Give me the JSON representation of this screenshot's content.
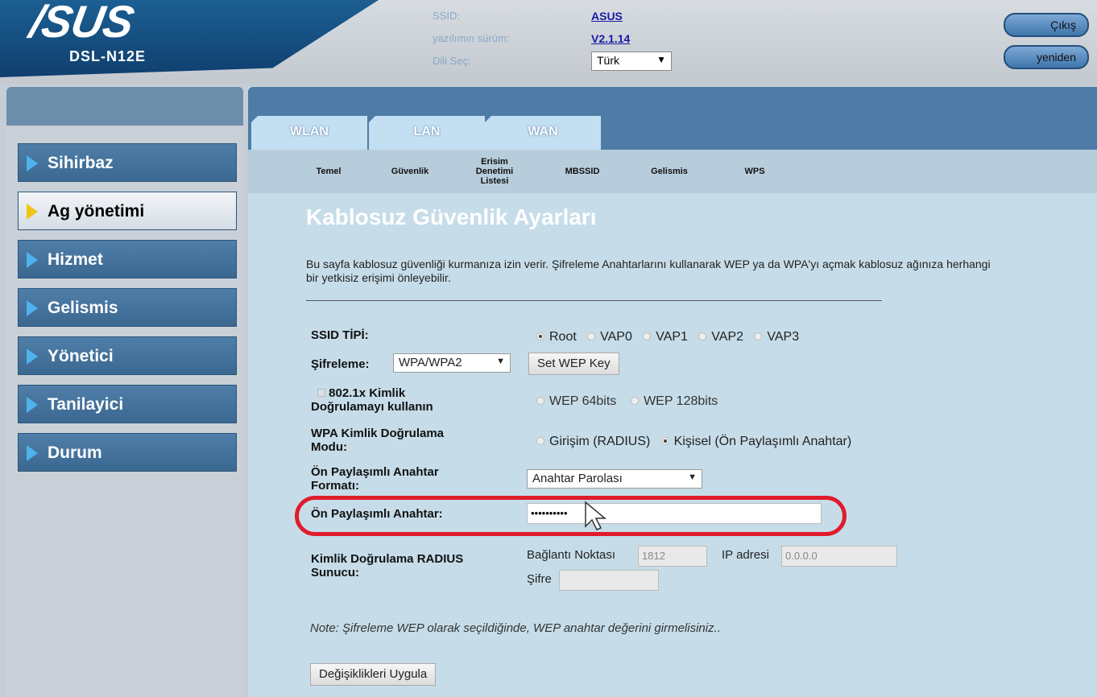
{
  "header": {
    "brand": "/SUS",
    "model": "DSL-N12E",
    "ssid_label": "SSID:",
    "ssid_value": "ASUS",
    "firmware_label": "yazılımın sürüm:",
    "firmware_value": "V2.1.14",
    "language_label": "Dili Seç:",
    "language_value": "Türk",
    "logout_label": "Çıkış",
    "reboot_label": "yeniden"
  },
  "sidebar": {
    "items": [
      {
        "label": "Sihirbaz"
      },
      {
        "label": "Ag yönetimi"
      },
      {
        "label": "Hizmet"
      },
      {
        "label": "Gelismis"
      },
      {
        "label": "Yönetici"
      },
      {
        "label": "Tanilayici"
      },
      {
        "label": "Durum"
      }
    ]
  },
  "tabs": [
    "WLAN",
    "LAN",
    "WAN"
  ],
  "subtabs": [
    "Temel",
    "Güvenlik",
    "Erisim Denetimi Listesi",
    "MBSSID",
    "Gelismis",
    "WPS"
  ],
  "page": {
    "title": "Kablosuz Güvenlik Ayarları",
    "description": "Bu sayfa kablosuz güvenliği kurmanıza izin verir. Şifreleme Anahtarlarını kullanarak WEP ya da WPA'yı açmak kablosuz ağınıza herhangi bir yetkisiz erişimi önleyebilir.",
    "ssid_type_label": "SSID TİPİ:",
    "ssid_types": [
      "Root",
      "VAP0",
      "VAP1",
      "VAP2",
      "VAP3"
    ],
    "encryption_label": "Şifreleme:",
    "encryption_value": "WPA/WPA2",
    "set_wep_key": "Set WEP Key",
    "dot1x_label_line1": "802.1x Kimlik",
    "dot1x_label_line2": "Doğrulamayı kullanın",
    "wep64": "WEP 64bits",
    "wep128": "WEP 128bits",
    "wpa_mode_label_line1": "WPA Kimlik Doğrulama",
    "wpa_mode_label_line2": "Modu:",
    "wpa_mode_enterprise": "Girişim (RADIUS)",
    "wpa_mode_personal": "Kişisel (Ön Paylaşımlı Anahtar)",
    "psk_format_label_line1": "Ön Paylaşımlı Anahtar",
    "psk_format_label_line2": "Formatı:",
    "psk_format_value": "Anahtar Parolası",
    "psk_label": "Ön Paylaşımlı Anahtar:",
    "psk_value": "••••••••••",
    "radius_label_line1": "Kimlik Doğrulama RADIUS",
    "radius_label_line2": "Sunucu:",
    "port_label": "Bağlantı Noktası",
    "port_value": "1812",
    "ip_label": "IP adresi",
    "ip_value": "0.0.0.0",
    "password_label": "Şifre",
    "note": "Note: Şifreleme WEP olarak seçildiğinde, WEP anahtar değerini girmelisiniz..",
    "apply_button": "Değişiklikleri Uygula"
  },
  "colors": {
    "sidebar_item": "#4f7ea8",
    "active_indicator": "#f0c419",
    "highlight": "#e01b2b",
    "main_bg": "#c6dde9"
  }
}
